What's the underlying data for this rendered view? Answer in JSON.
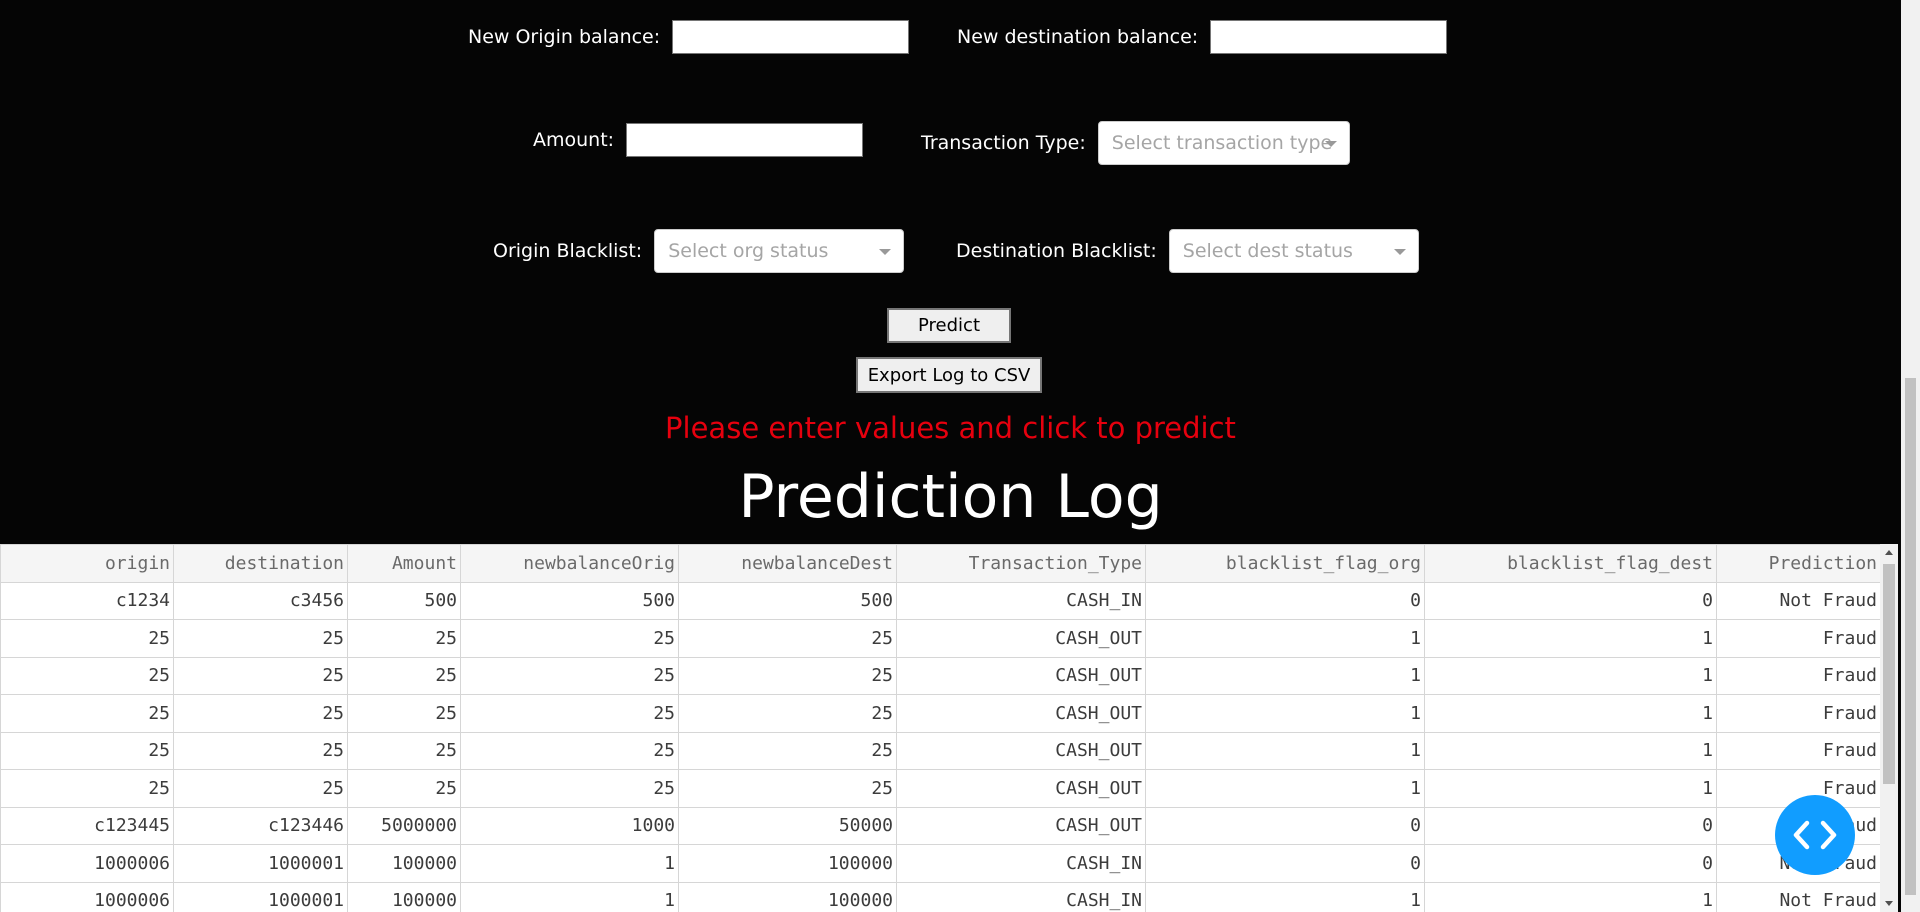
{
  "form": {
    "new_origin_balance_label": "New Origin balance:",
    "new_destination_balance_label": "New destination balance:",
    "amount_label": "Amount:",
    "transaction_type_label": "Transaction Type:",
    "transaction_type_placeholder": "Select transaction type",
    "origin_blacklist_label": "Origin Blacklist:",
    "origin_blacklist_placeholder": "Select org status",
    "destination_blacklist_label": "Destination Blacklist:",
    "destination_blacklist_placeholder": "Select dest status"
  },
  "buttons": {
    "predict": "Predict",
    "export": "Export Log to CSV"
  },
  "status_message": "Please enter values and click to predict",
  "log_title": "Prediction Log",
  "colors": {
    "background": "#050505",
    "status": "#e6000e",
    "fab": "#119dff"
  },
  "icons": {
    "dropdown": "chevron-down-icon",
    "fab": "code-brackets-icon"
  },
  "table": {
    "columns": [
      "origin",
      "destination",
      "Amount",
      "newbalanceOrig",
      "newbalanceDest",
      "Transaction_Type",
      "blacklist_flag_org",
      "blacklist_flag_dest",
      "Prediction"
    ],
    "rows": [
      [
        "c1234",
        "c3456",
        "500",
        "500",
        "500",
        "CASH_IN",
        "0",
        "0",
        "Not Fraud"
      ],
      [
        "25",
        "25",
        "25",
        "25",
        "25",
        "CASH_OUT",
        "1",
        "1",
        "Fraud"
      ],
      [
        "25",
        "25",
        "25",
        "25",
        "25",
        "CASH_OUT",
        "1",
        "1",
        "Fraud"
      ],
      [
        "25",
        "25",
        "25",
        "25",
        "25",
        "CASH_OUT",
        "1",
        "1",
        "Fraud"
      ],
      [
        "25",
        "25",
        "25",
        "25",
        "25",
        "CASH_OUT",
        "1",
        "1",
        "Fraud"
      ],
      [
        "25",
        "25",
        "25",
        "25",
        "25",
        "CASH_OUT",
        "1",
        "1",
        "Fraud"
      ],
      [
        "c123445",
        "c123446",
        "5000000",
        "1000",
        "50000",
        "CASH_OUT",
        "0",
        "0",
        "Fraud"
      ],
      [
        "1000006",
        "1000001",
        "100000",
        "1",
        "100000",
        "CASH_IN",
        "0",
        "0",
        "Not Fraud"
      ],
      [
        "1000006",
        "1000001",
        "100000",
        "1",
        "100000",
        "CASH_IN",
        "1",
        "1",
        "Not Fraud"
      ]
    ]
  }
}
